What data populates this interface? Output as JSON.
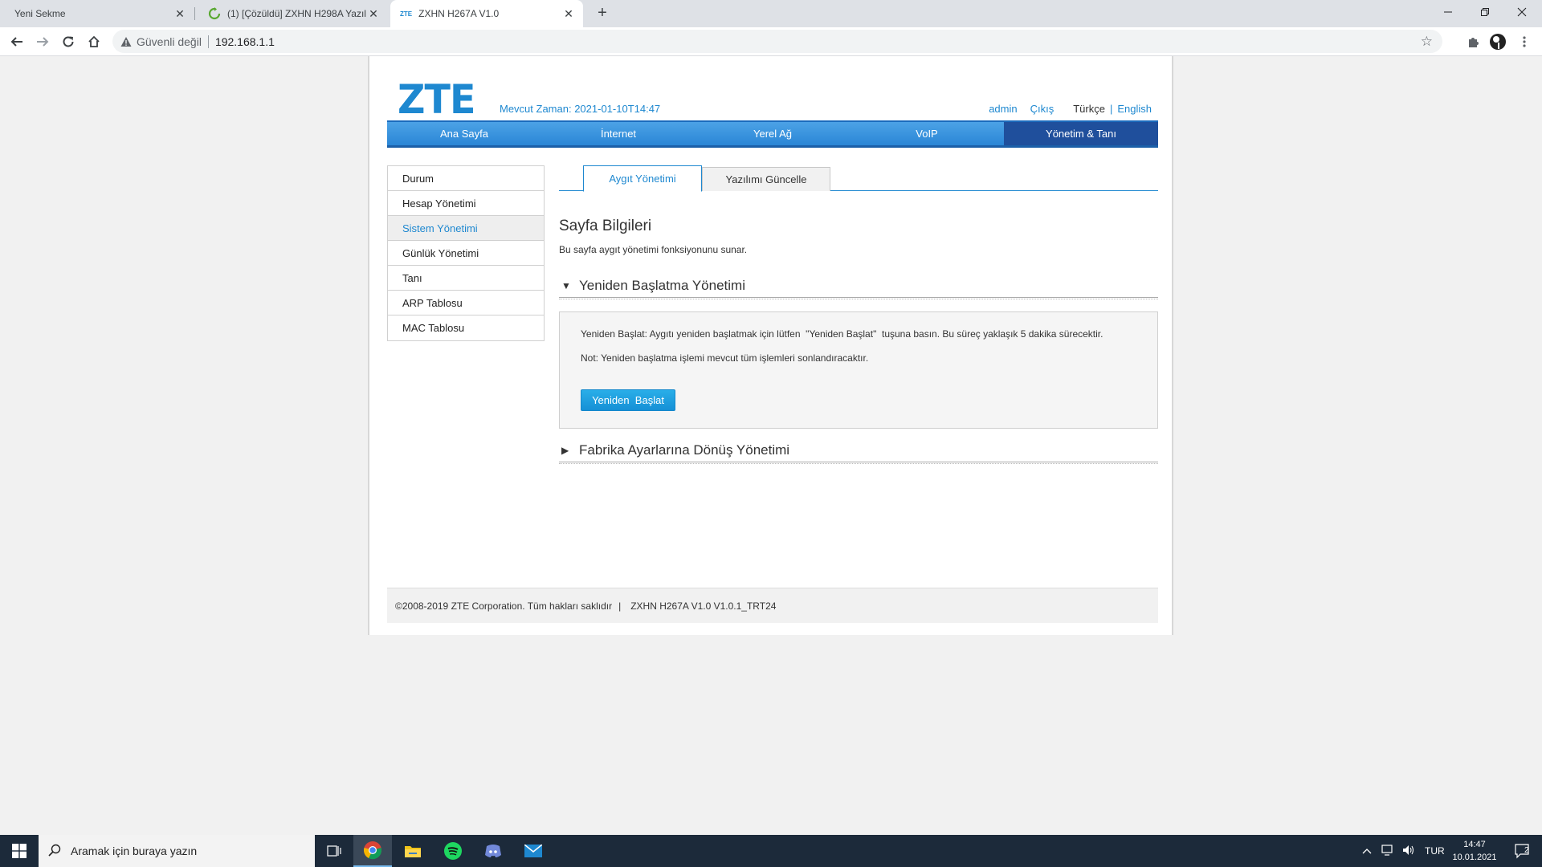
{
  "browser": {
    "tabs": [
      {
        "title": "Yeni Sekme"
      },
      {
        "title": "(1) [Çözüldü] ZXHN H298A Yazılı"
      },
      {
        "title": "ZXHN H267A V1.0",
        "favicon_text": "ZTE"
      }
    ],
    "address": {
      "security_label": "Güvenli değil",
      "url": "192.168.1.1"
    }
  },
  "router": {
    "logo": "ZTE",
    "current_time": "Mevcut Zaman: 2021-01-10T14:47",
    "header_links": {
      "user": "admin",
      "logout": "Çıkış",
      "lang_tr": "Türkçe",
      "separator": "|",
      "lang_en": "English"
    },
    "main_nav": [
      {
        "label": "Ana Sayfa"
      },
      {
        "label": "İnternet"
      },
      {
        "label": "Yerel Ağ"
      },
      {
        "label": "VoIP"
      },
      {
        "label": "Yönetim & Tanı"
      }
    ],
    "side_menu": [
      {
        "label": "Durum"
      },
      {
        "label": "Hesap Yönetimi"
      },
      {
        "label": "Sistem Yönetimi"
      },
      {
        "label": "Günlük Yönetimi"
      },
      {
        "label": "Tanı"
      },
      {
        "label": "ARP Tablosu"
      },
      {
        "label": "MAC Tablosu"
      }
    ],
    "sub_tabs": [
      {
        "label": "Aygıt Yönetimi"
      },
      {
        "label": "Yazılımı Güncelle"
      }
    ],
    "page_title": "Sayfa Bilgileri",
    "page_desc": "Bu sayfa aygıt yönetimi fonksiyonunu sunar.",
    "reboot_section": {
      "title": "Yeniden Başlatma Yönetimi",
      "line1": "Yeniden Başlat: Aygıtı yeniden başlatmak için lütfen   \"Yeniden Başlat\"  tuşuna basın. Bu süreç yaklaşık 5 dakika sürecektir.",
      "line2": "Not: Yeniden başlatma işlemi mevcut tüm işlemleri sonlandıracaktır.",
      "button": "Yeniden  Başlat"
    },
    "factory_section": {
      "title": "Fabrika Ayarlarına Dönüş Yönetimi"
    },
    "footer": {
      "copyright": "©2008-2019 ZTE Corporation. Tüm hakları saklıdır",
      "separator": "|",
      "version": "ZXHN H267A V1.0 V1.0.1_TRT24"
    },
    "colors": {
      "accent": "#1e88d0",
      "nav_active": "#1f4f9c",
      "button": "#1690d6"
    }
  },
  "taskbar": {
    "search_placeholder": "Aramak için buraya yazın",
    "language": "TUR",
    "time": "14:47",
    "date": "10.01.2021",
    "notification_count": "2"
  }
}
